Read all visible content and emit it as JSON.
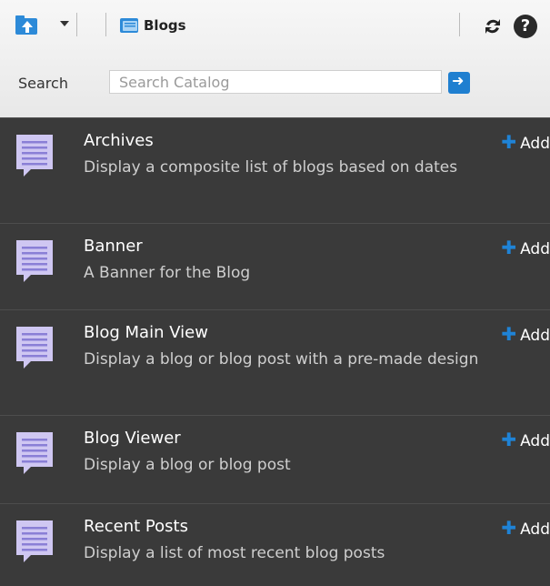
{
  "toolbar": {
    "title": "Blogs",
    "up_icon": "up-folder-icon",
    "dropdown_icon": "chevron-down-icon",
    "folder_icon": "folder-icon",
    "refresh_icon": "refresh-icon",
    "help_label": "?"
  },
  "search": {
    "label": "Search",
    "placeholder": "Search Catalog"
  },
  "items": [
    {
      "title": "Archives",
      "desc": "Display a composite list of blogs based on dates",
      "add": "Add"
    },
    {
      "title": "Banner",
      "desc": "A Banner for the Blog",
      "add": "Add"
    },
    {
      "title": "Blog Main View",
      "desc": "Display a blog or blog post with a pre-made design",
      "add": "Add"
    },
    {
      "title": "Blog Viewer",
      "desc": "Display a blog or blog post",
      "add": "Add"
    },
    {
      "title": "Recent Posts",
      "desc": "Display a list of most recent blog posts",
      "add": "Add"
    }
  ],
  "colors": {
    "panel_bg": "#3a3a3a",
    "accent": "#1f83d6"
  }
}
